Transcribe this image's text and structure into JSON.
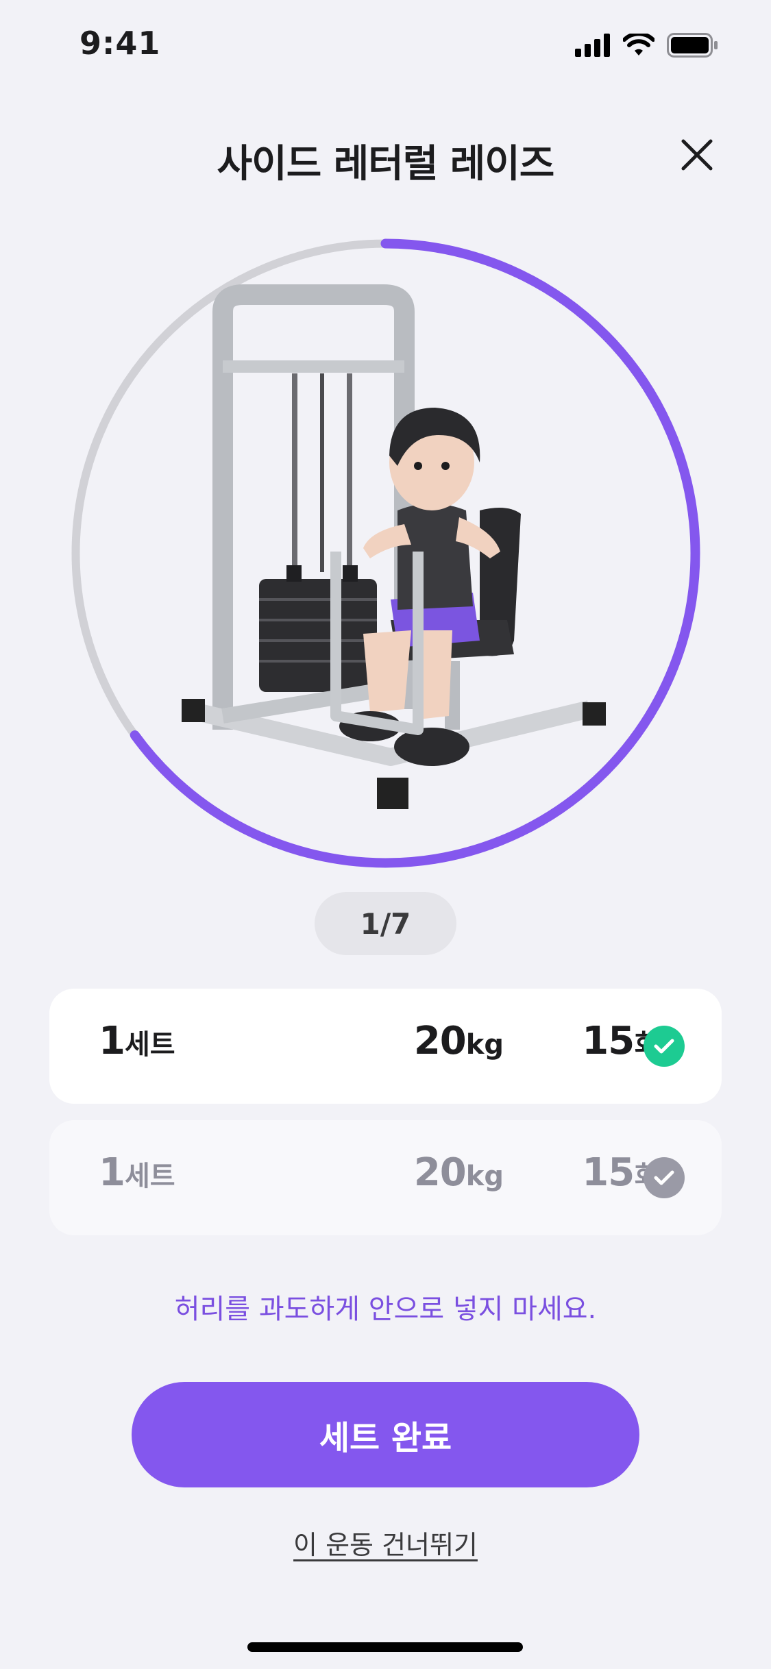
{
  "status_bar": {
    "time": "9:41"
  },
  "header": {
    "title": "사이드 레터럴 레이즈"
  },
  "progress": {
    "fraction": 0.65
  },
  "counter": "1/7",
  "sets": [
    {
      "set_number": "1",
      "set_unit": "세트",
      "weight_value": "20",
      "weight_unit": "kg",
      "reps_value": "15",
      "reps_unit": "회",
      "state": "completed"
    },
    {
      "set_number": "1",
      "set_unit": "세트",
      "weight_value": "20",
      "weight_unit": "kg",
      "reps_value": "15",
      "reps_unit": "회",
      "state": "pending"
    }
  ],
  "tip": "허리를 과도하게 안으로 넣지 마세요.",
  "actions": {
    "complete_set": "세트 완료",
    "skip_exercise": "이 운동 건너뛰기"
  },
  "colors": {
    "accent": "#8457EE",
    "success": "#1DCB92",
    "muted": "#9A9AA6",
    "ring_track": "#D1D1D6"
  }
}
